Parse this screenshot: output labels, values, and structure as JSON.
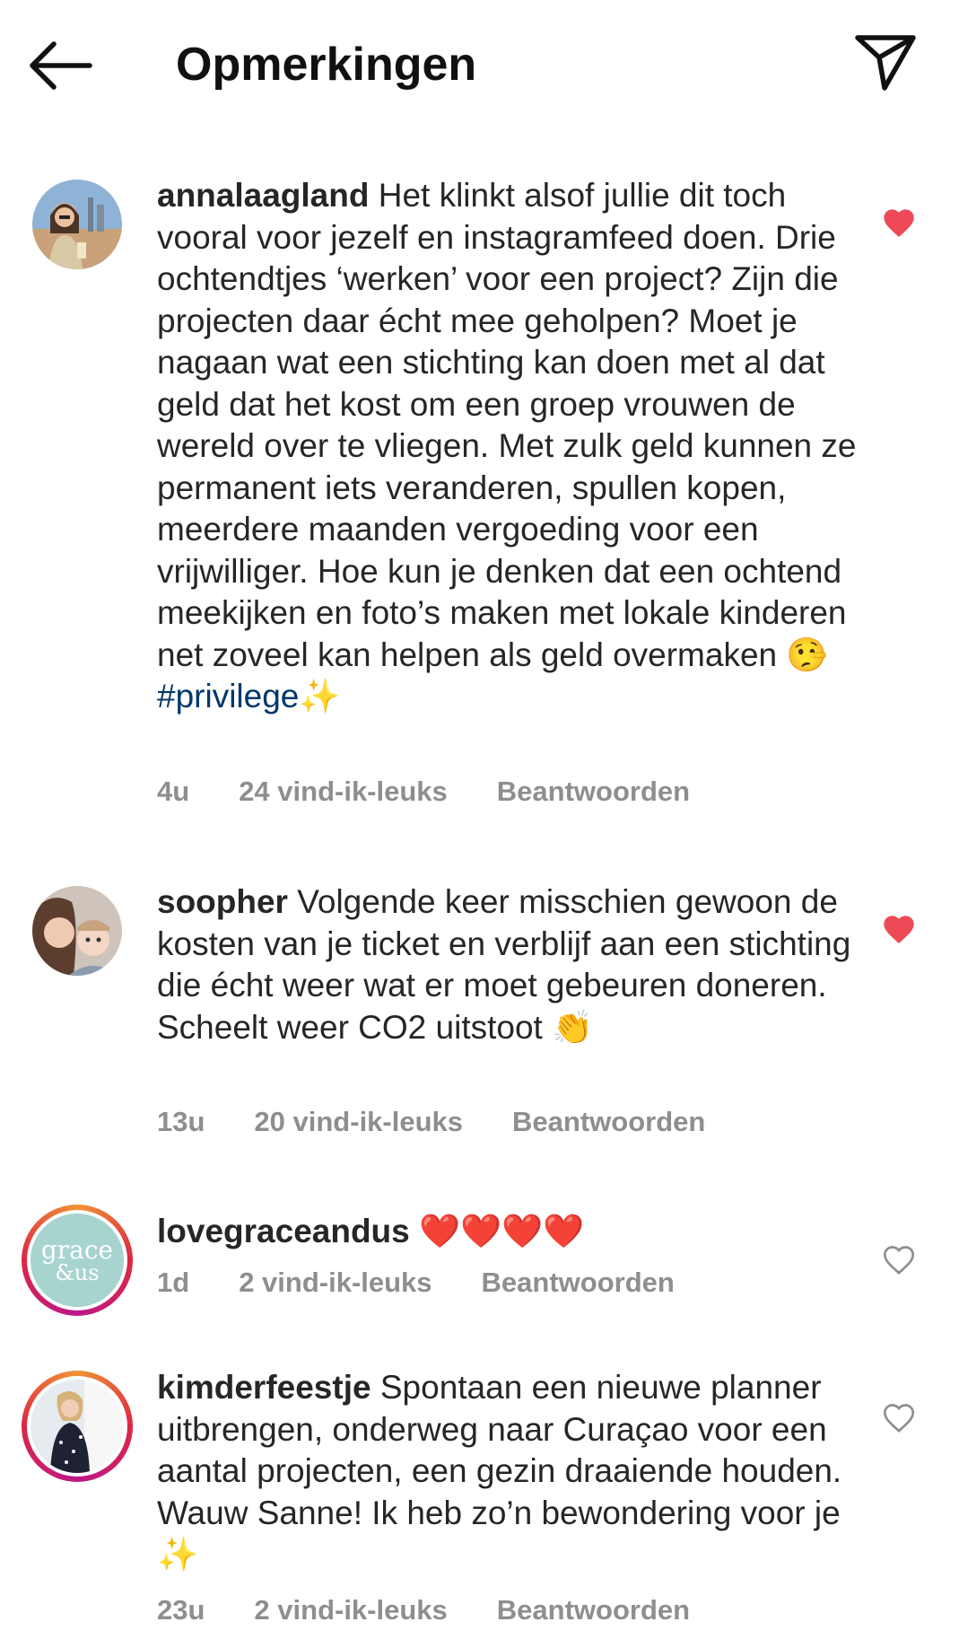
{
  "header": {
    "title": "Opmerkingen",
    "back_icon": "arrow-left-icon",
    "share_icon": "paper-plane-icon"
  },
  "comments": [
    {
      "username": "annalaagland",
      "text": "Het klinkt alsof jullie dit toch vooral voor jezelf en instagramfeed doen. Drie ochtendtjes ‘werken’ voor een project? Zijn die projecten daar écht mee geholpen? Moet je nagaan wat een stichting kan doen met al dat geld dat het kost om een groep vrouwen de wereld over te vliegen. Met zulk geld kunnen ze permanent iets veranderen, spullen kopen, meerdere maanden vergoeding voor een vrijwilliger. Hoe kun je denken dat een ochtend meekijken en foto’s maken met lokale kinderen net zoveel kan helpen als geld overmaken 🤥",
      "hashtag": "#privilege",
      "hashtag_emoji": "✨",
      "time": "4u",
      "likes": "24 vind-ik-leuks",
      "reply": "Beantwoorden",
      "liked": true
    },
    {
      "username": "soopher",
      "text": "Volgende keer misschien gewoon de kosten van je ticket en verblijf aan een stichting die écht weer wat er moet gebeuren doneren. Scheelt weer CO2 uitstoot 👏",
      "time": "13u",
      "likes": "20 vind-ik-leuks",
      "reply": "Beantwoorden",
      "liked": true
    },
    {
      "username": "lovegraceandus",
      "text": "❤️❤️❤️❤️",
      "avatar_text": "grace &us",
      "time": "1d",
      "likes": "2 vind-ik-leuks",
      "reply": "Beantwoorden",
      "liked": false
    },
    {
      "username": "kimderfeestje",
      "text": "Spontaan een nieuwe planner uitbrengen, onderweg naar Curaçao voor een aantal projecten, een gezin draaiende houden. Wauw Sanne! Ik heb zo’n bewondering voor je ✨",
      "time": "23u",
      "likes": "2 vind-ik-leuks",
      "reply": "Beantwoorden",
      "liked": false
    }
  ],
  "colors": {
    "liked_heart": "#ed4956",
    "meta_grey": "#8e8e8e",
    "hashtag_blue": "#00376b"
  }
}
